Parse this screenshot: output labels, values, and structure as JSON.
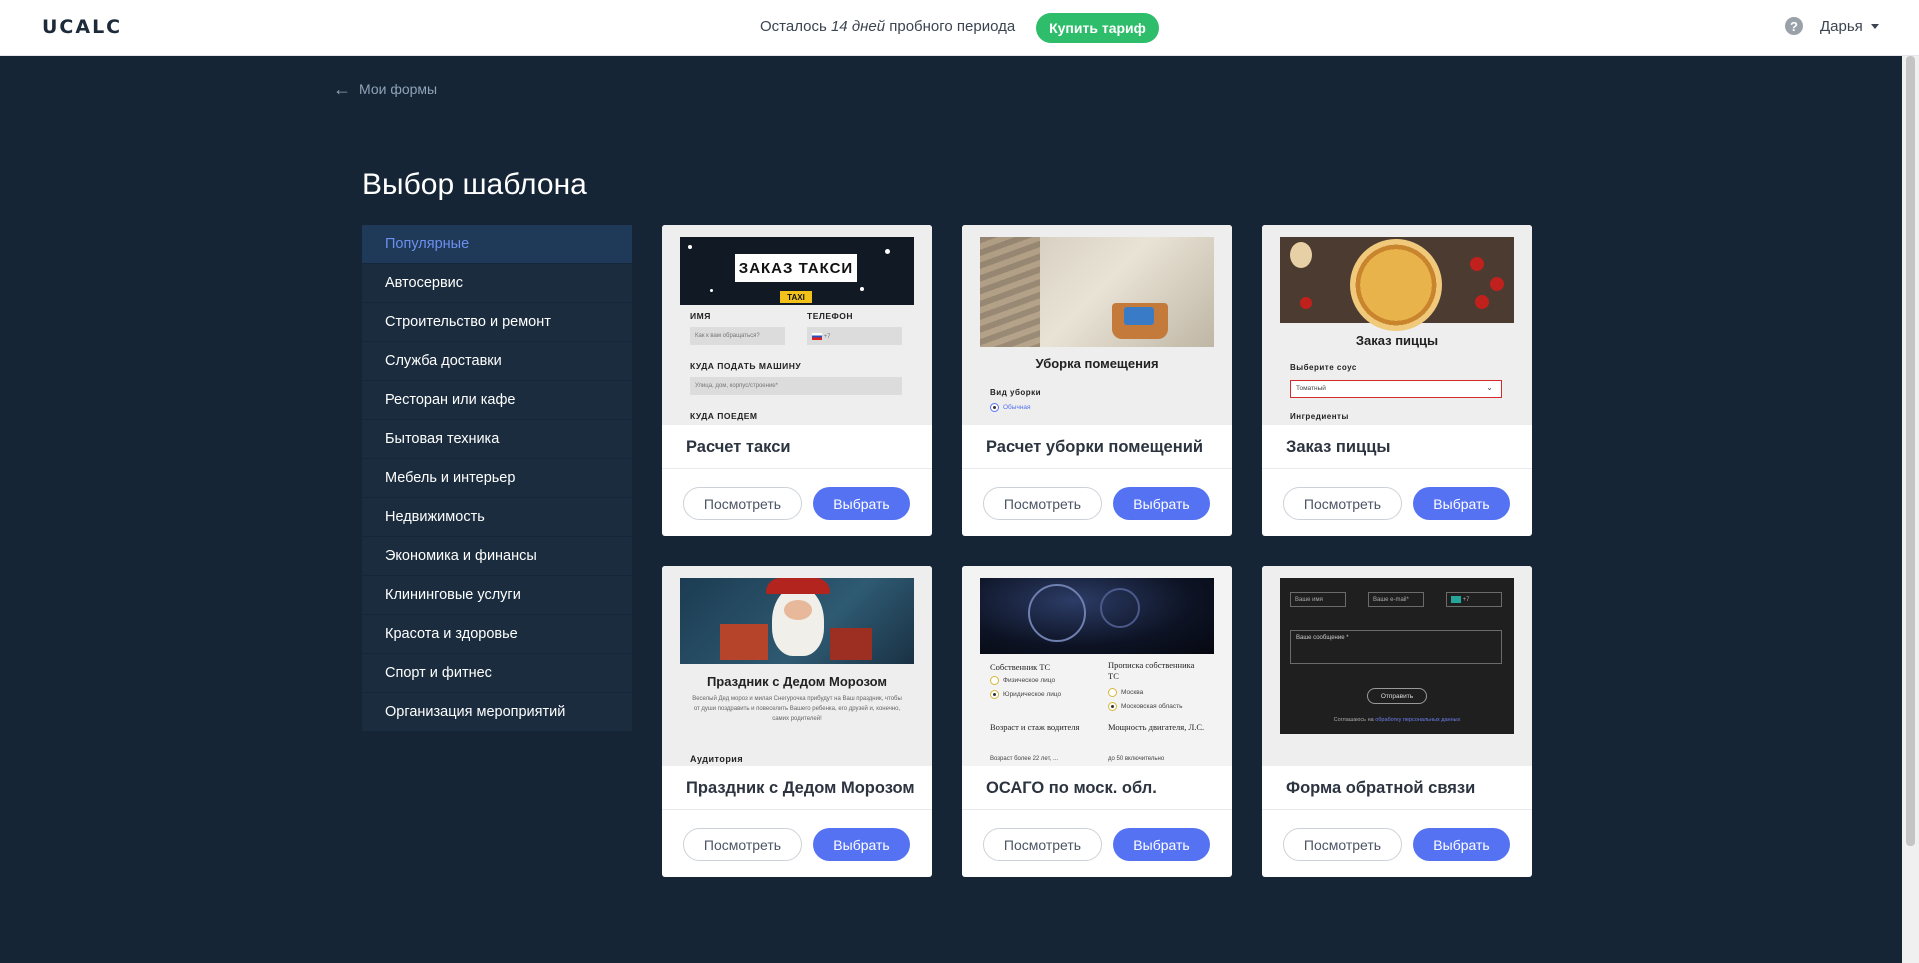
{
  "header": {
    "logo": "UCALC",
    "trial_prefix": "Осталось",
    "trial_days": "14 дней",
    "trial_suffix": "пробного периода",
    "buy_label": "Купить тариф",
    "help_icon": "question-circle-icon",
    "user_name": "Дарья"
  },
  "nav": {
    "back_label": "Мои формы"
  },
  "page": {
    "title": "Выбор шаблона"
  },
  "sidebar": {
    "items": [
      {
        "label": "Популярные",
        "active": true
      },
      {
        "label": "Автосервис"
      },
      {
        "label": "Строительство и ремонт"
      },
      {
        "label": "Служба доставки"
      },
      {
        "label": "Ресторан или кафе"
      },
      {
        "label": "Бытовая техника"
      },
      {
        "label": "Мебель и интерьер"
      },
      {
        "label": "Недвижимость"
      },
      {
        "label": "Экономика и финансы"
      },
      {
        "label": "Клининговые услуги"
      },
      {
        "label": "Красота и здоровье"
      },
      {
        "label": "Спорт и фитнес"
      },
      {
        "label": "Организация мероприятий"
      }
    ]
  },
  "buttons": {
    "view": "Посмотреть",
    "select": "Выбрать"
  },
  "templates": [
    {
      "title": "Расчет такси",
      "preview": {
        "banner": "ЗАКАЗ ТАКСИ",
        "badge": "TAXI",
        "name_label": "ИМЯ",
        "phone_label": "ТЕЛЕФОН",
        "name_placeholder": "Как к вам обращаться?",
        "phone_prefix": "+7",
        "pickup_label": "КУДА ПОДАТЬ МАШИНУ",
        "pickup_placeholder": "Улица, дом, корпус/строение*",
        "dest_label": "КУДА ПОЕДЕМ"
      }
    },
    {
      "title": "Расчет уборки помещений",
      "preview": {
        "heading": "Уборка помещения",
        "type_label": "Вид уборки",
        "option": "Обычная"
      }
    },
    {
      "title": "Заказ пиццы",
      "preview": {
        "heading": "Заказ пиццы",
        "sauce_label": "Выберите соус",
        "sauce_value": "Томатный",
        "ingredients_label": "Ингредиенты"
      }
    },
    {
      "title": "Праздник с Дедом Морозом",
      "preview": {
        "heading": "Праздник с Дедом Морозом",
        "text": "Веселый Дед мороз и милая Снегурочка прибудут на Ваш праздник, чтобы от души поздравить и повеселить Вашего ребенка, его друзей и, конечно, самих родителей!",
        "audience_label": "Аудитория"
      }
    },
    {
      "title": "ОСАГО по моск. обл.",
      "preview": {
        "owner_label": "Собственник ТС",
        "owner_opt1": "Физическое лицо",
        "owner_opt2": "Юридическое лицо",
        "reg_label": "Прописка собственника ТС",
        "reg_opt1": "Москва",
        "reg_opt2": "Московская область",
        "age_label": "Возраст и стаж водителя",
        "age_value": "Возраст более 22 лет, ...",
        "power_label": "Мощность двигателя, Л.С.",
        "power_value": "до 50 включительно"
      }
    },
    {
      "title": "Форма обратной связи",
      "preview": {
        "name_placeholder": "Ваше имя",
        "email_placeholder": "Ваше e-mail*",
        "phone_prefix": "+7",
        "message_placeholder": "Ваше сообщение *",
        "send_label": "Отправить",
        "consent_prefix": "Соглашаюсь на",
        "consent_link": "обработку персональных данных"
      }
    }
  ]
}
